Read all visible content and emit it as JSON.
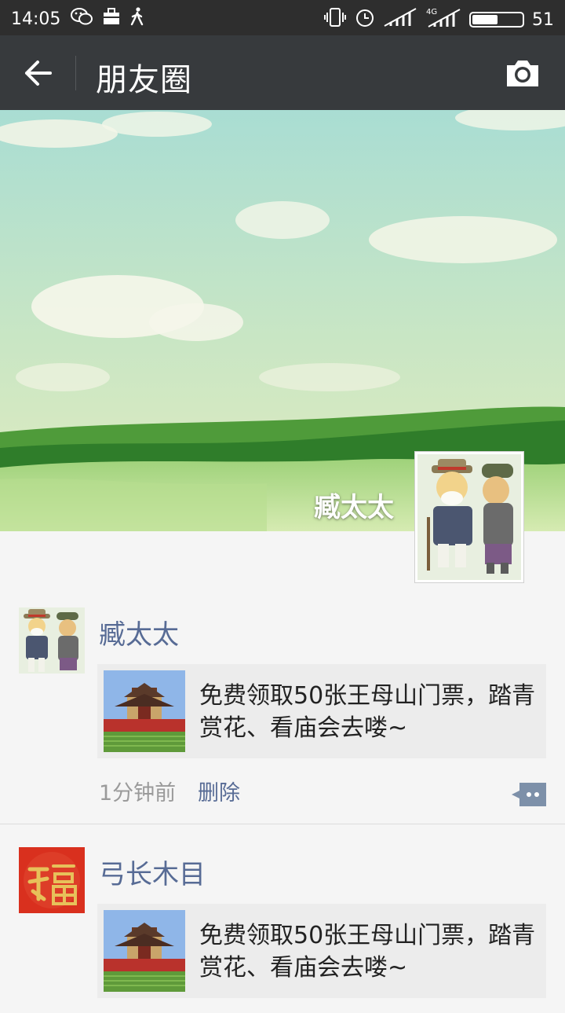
{
  "status_bar": {
    "time": "14:05",
    "network": "4G",
    "battery": "51",
    "battery_level": 0.51,
    "icons": [
      "wechat-icon",
      "bag-icon",
      "walking-icon",
      "vibrate-icon",
      "alarm-icon",
      "signal-icon",
      "signal-4g-icon",
      "battery-icon"
    ]
  },
  "header": {
    "title": "朋友圈",
    "back_icon": "back-arrow-icon",
    "camera_icon": "camera-icon"
  },
  "cover": {
    "name": "臧太太"
  },
  "posts": [
    {
      "username": "臧太太",
      "share_text": "免费领取50张王母山门票，踏青赏花、看庙会去喽~",
      "time": "1分钟前",
      "delete_label": "删除"
    },
    {
      "username": "弓长木目",
      "share_text": "免费领取50张王母山门票，踏青赏花、看庙会去喽~"
    }
  ],
  "colors": {
    "header_bg": "#373a3d",
    "status_bg": "#2e2e2e",
    "username": "#576b95",
    "card_bg": "#ececec"
  }
}
